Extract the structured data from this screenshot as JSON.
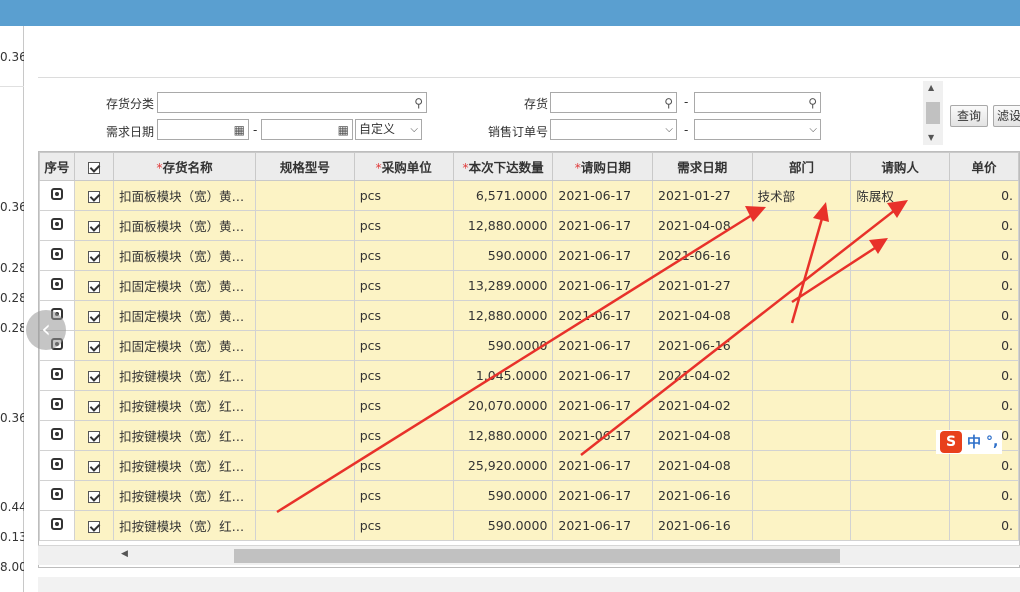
{
  "left_partial_values": [
    "0.36",
    "0.36",
    "0.28",
    "0.28",
    "0.28",
    "0.36",
    "0.44",
    "0.13",
    "8.00"
  ],
  "filters": {
    "category_label": "存货分类",
    "demand_date_label": "需求日期",
    "inventory_label": "存货",
    "sales_order_label": "销售订单号",
    "date_range_select": "自定义",
    "dash": "-"
  },
  "buttons": {
    "query": "查询",
    "filter": "滤设"
  },
  "grid": {
    "headers": {
      "seq": "序号",
      "name": "存货名称",
      "spec": "规格型号",
      "unit": "采购单位",
      "qty": "本次下达数量",
      "req_date": "请购日期",
      "need_date": "需求日期",
      "dept": "部门",
      "requester": "请购人",
      "price": "单价"
    },
    "rows": [
      {
        "name": "扣面板模块（宽）黄…",
        "spec": "",
        "unit": "pcs",
        "qty": "6,571.0000",
        "req_date": "2021-06-17",
        "need_date": "2021-01-27",
        "dept": "技术部",
        "requester": "陈展权",
        "price": "0."
      },
      {
        "name": "扣面板模块（宽）黄…",
        "spec": "",
        "unit": "pcs",
        "qty": "12,880.0000",
        "req_date": "2021-06-17",
        "need_date": "2021-04-08",
        "dept": "",
        "requester": "",
        "price": "0."
      },
      {
        "name": "扣面板模块（宽）黄…",
        "spec": "",
        "unit": "pcs",
        "qty": "590.0000",
        "req_date": "2021-06-17",
        "need_date": "2021-06-16",
        "dept": "",
        "requester": "",
        "price": "0."
      },
      {
        "name": "扣固定模块（宽）黄…",
        "spec": "",
        "unit": "pcs",
        "qty": "13,289.0000",
        "req_date": "2021-06-17",
        "need_date": "2021-01-27",
        "dept": "",
        "requester": "",
        "price": "0."
      },
      {
        "name": "扣固定模块（宽）黄…",
        "spec": "",
        "unit": "pcs",
        "qty": "12,880.0000",
        "req_date": "2021-06-17",
        "need_date": "2021-04-08",
        "dept": "",
        "requester": "",
        "price": "0."
      },
      {
        "name": "扣固定模块（宽）黄…",
        "spec": "",
        "unit": "pcs",
        "qty": "590.0000",
        "req_date": "2021-06-17",
        "need_date": "2021-06-16",
        "dept": "",
        "requester": "",
        "price": "0."
      },
      {
        "name": "扣按键模块（宽）红…",
        "spec": "",
        "unit": "pcs",
        "qty": "1,045.0000",
        "req_date": "2021-06-17",
        "need_date": "2021-04-02",
        "dept": "",
        "requester": "",
        "price": "0."
      },
      {
        "name": "扣按键模块（宽）红…",
        "spec": "",
        "unit": "pcs",
        "qty": "20,070.0000",
        "req_date": "2021-06-17",
        "need_date": "2021-04-02",
        "dept": "",
        "requester": "",
        "price": "0."
      },
      {
        "name": "扣按键模块（宽）红…",
        "spec": "",
        "unit": "pcs",
        "qty": "12,880.0000",
        "req_date": "2021-06-17",
        "need_date": "2021-04-08",
        "dept": "",
        "requester": "",
        "price": "0."
      },
      {
        "name": "扣按键模块（宽）红…",
        "spec": "",
        "unit": "pcs",
        "qty": "25,920.0000",
        "req_date": "2021-06-17",
        "need_date": "2021-04-08",
        "dept": "",
        "requester": "",
        "price": "0."
      },
      {
        "name": "扣按键模块（宽）红…",
        "spec": "",
        "unit": "pcs",
        "qty": "590.0000",
        "req_date": "2021-06-17",
        "need_date": "2021-06-16",
        "dept": "",
        "requester": "",
        "price": "0."
      },
      {
        "name": "扣按键模块（宽）红…",
        "spec": "",
        "unit": "pcs",
        "qty": "590.0000",
        "req_date": "2021-06-17",
        "need_date": "2021-06-16",
        "dept": "",
        "requester": "",
        "price": "0."
      }
    ]
  },
  "ime": {
    "logo": "S",
    "mode": "中",
    "punct": "°,"
  },
  "colors": {
    "topbar": "#5a9fd0",
    "row_bg": "#fcf3c5",
    "arrow": "#e8312a",
    "required": "#e03a3a"
  }
}
